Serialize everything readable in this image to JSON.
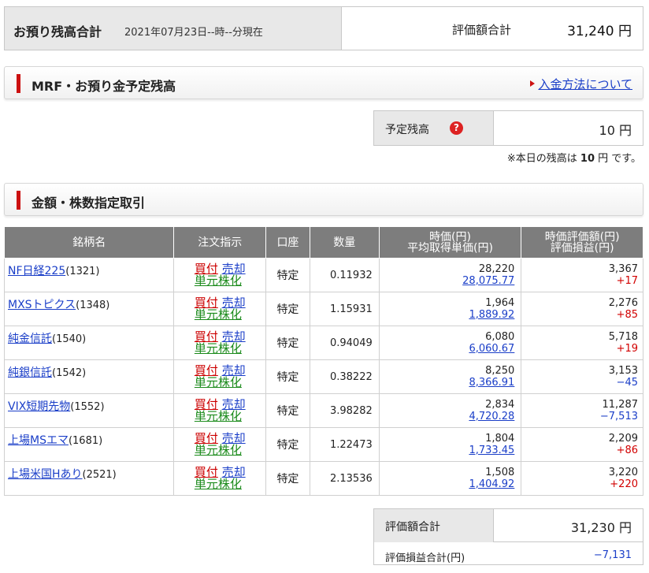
{
  "summary": {
    "title": "お預り残高合計",
    "date": "2021年07月23日--時--分現在",
    "total_label": "評価額合計",
    "total_value": "31,240 円"
  },
  "mrf": {
    "title": "MRF・お預り金予定残高",
    "link": "入金方法について",
    "scheduled_label": "予定残高",
    "scheduled_value": "10 円",
    "note_prefix": "※本日の残高は",
    "note_value": "10",
    "note_suffix": "円 です。"
  },
  "trade": {
    "title": "金額・株数指定取引"
  },
  "table": {
    "headers": {
      "name": "銘柄名",
      "order": "注文指示",
      "account": "口座",
      "qty": "数量",
      "price1": "時価(円)",
      "price2": "平均取得単価(円)",
      "value1": "時価評価額(円)",
      "value2": "評価損益(円)"
    },
    "buy_label": "買付",
    "sell_label": "売却",
    "unit_label": "単元株化",
    "rows": [
      {
        "name": "NF日経225",
        "code": "(1321)",
        "account": "特定",
        "qty": "0.11932",
        "price": "28,220",
        "avg": "28,075.77",
        "value": "3,367",
        "pl": "+17"
      },
      {
        "name": "MXSトピクス",
        "code": "(1348)",
        "account": "特定",
        "qty": "1.15931",
        "price": "1,964",
        "avg": "1,889.92",
        "value": "2,276",
        "pl": "+85"
      },
      {
        "name": "純金信託",
        "code": "(1540)",
        "account": "特定",
        "qty": "0.94049",
        "price": "6,080",
        "avg": "6,060.67",
        "value": "5,718",
        "pl": "+19"
      },
      {
        "name": "純銀信託",
        "code": "(1542)",
        "account": "特定",
        "qty": "0.38222",
        "price": "8,250",
        "avg": "8,366.91",
        "value": "3,153",
        "pl": "−45"
      },
      {
        "name": "VIX短期先物",
        "code": "(1552)",
        "account": "特定",
        "qty": "3.98282",
        "price": "2,834",
        "avg": "4,720.28",
        "value": "11,287",
        "pl": "−7,513"
      },
      {
        "name": "上場MSエマ",
        "code": "(1681)",
        "account": "特定",
        "qty": "1.22473",
        "price": "1,804",
        "avg": "1,733.45",
        "value": "2,209",
        "pl": "+86"
      },
      {
        "name": "上場米国Hあり",
        "code": "(2521)",
        "account": "特定",
        "qty": "2.13536",
        "price": "1,508",
        "avg": "1,404.92",
        "value": "3,220",
        "pl": "+220"
      }
    ]
  },
  "totals": {
    "value_label": "評価額合計",
    "value": "31,230 円",
    "pl_label": "評価損益合計(円)",
    "pl": "−7,131"
  },
  "colors": {
    "accent_red": "#cc1111",
    "link_blue": "#1a3ec8",
    "unit_green": "#1a8a1a",
    "header_gray": "#7d7d7d"
  }
}
